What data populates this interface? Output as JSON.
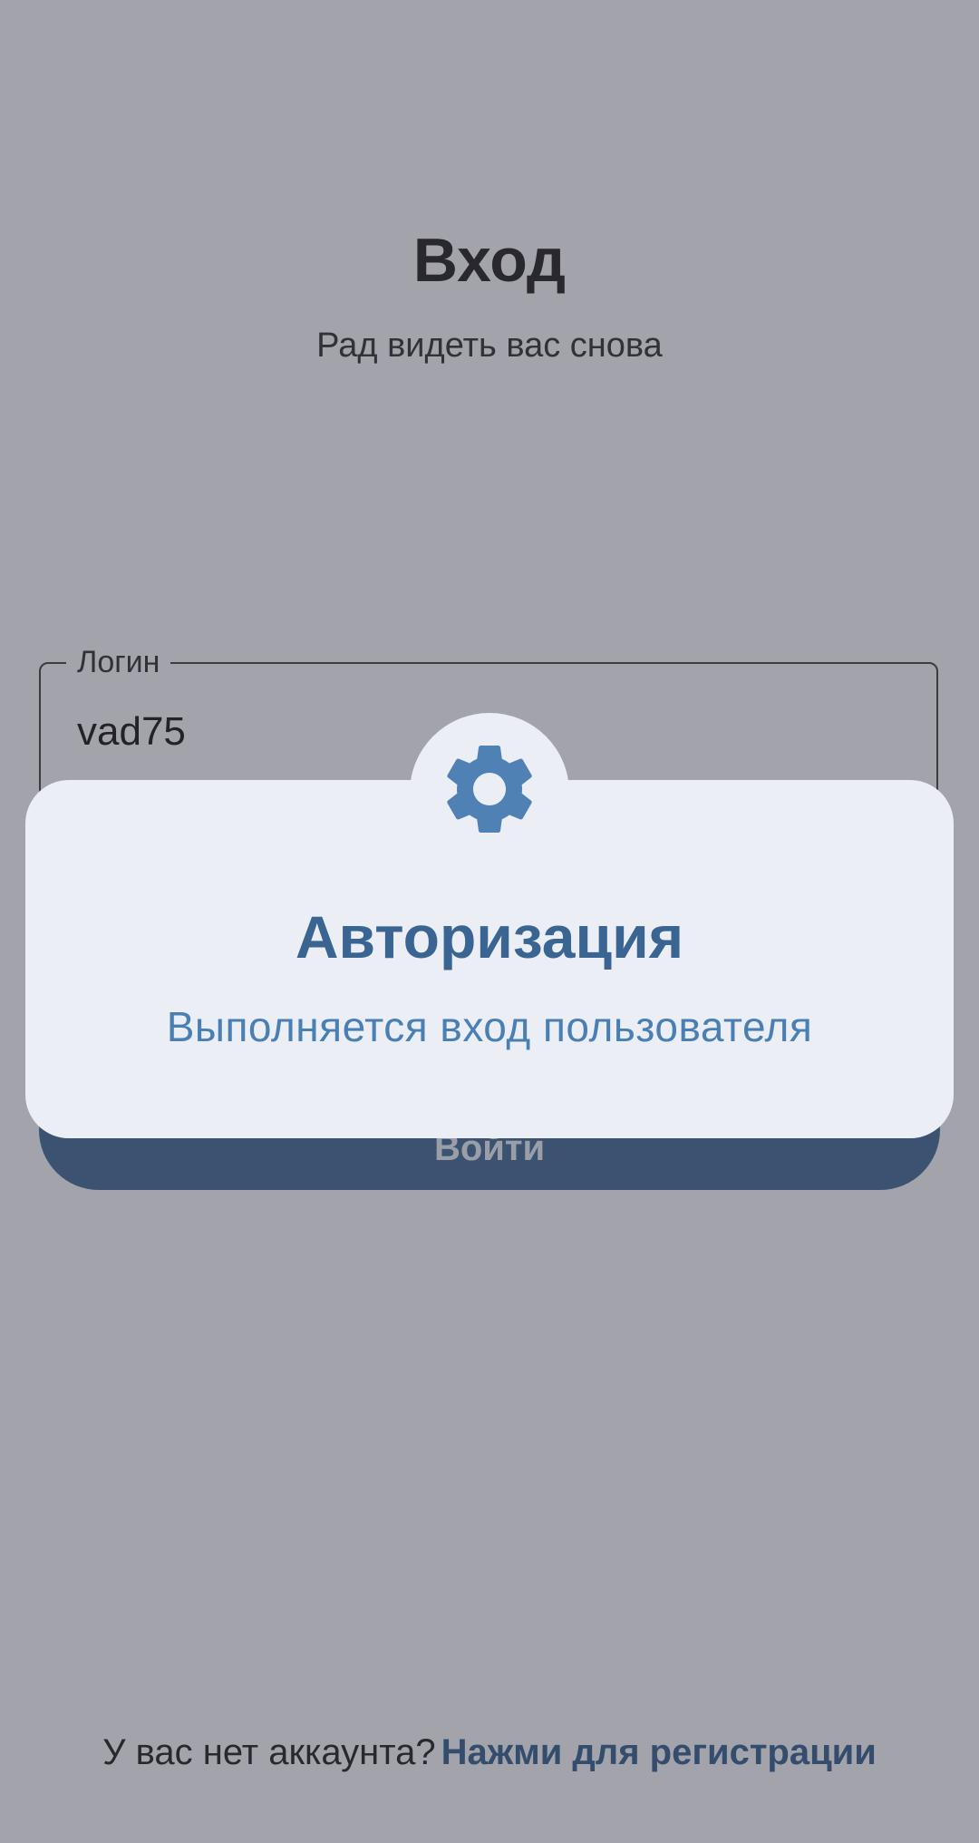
{
  "header": {
    "title": "Вход",
    "subtitle": "Рад видеть вас снова"
  },
  "form": {
    "login_label": "Логин",
    "login_value": "vad75",
    "submit_label": "Войти"
  },
  "footer": {
    "prompt": "У вас нет аккаунта?",
    "register_link": "Нажми для регистрации"
  },
  "dialog": {
    "icon": "gear-icon",
    "title": "Авторизация",
    "message": "Выполняется вход пользователя"
  },
  "colors": {
    "accent": "#3c6592",
    "dialog_title": "#3a6592",
    "dialog_message": "#4a7fb3",
    "icon": "#4f81b4",
    "surface": "#eceef5"
  }
}
